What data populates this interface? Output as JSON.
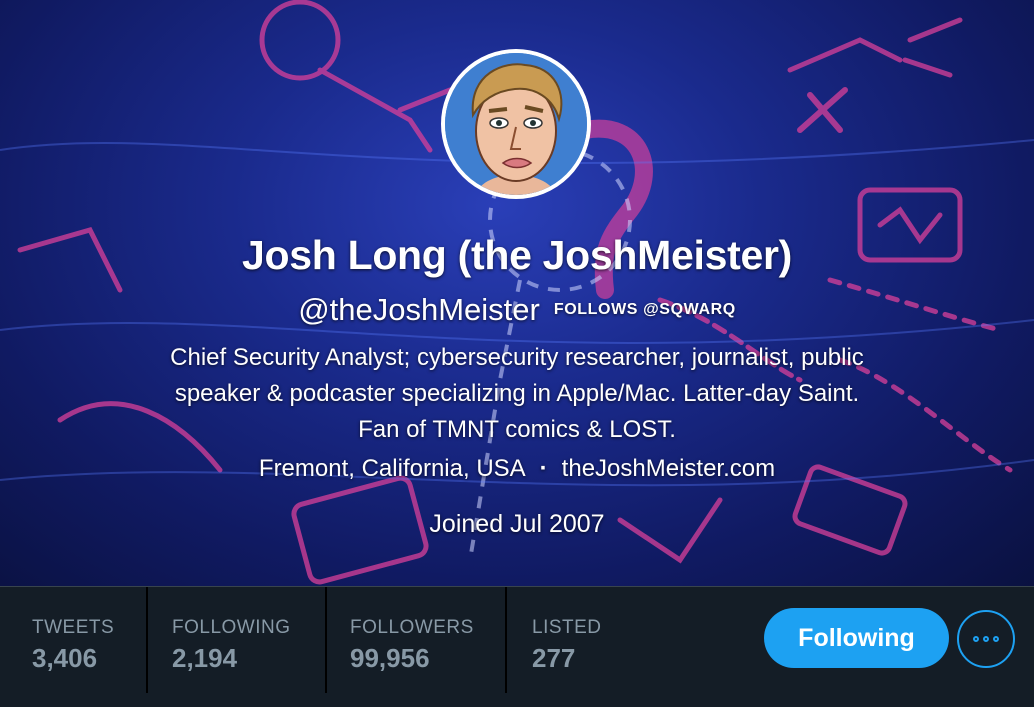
{
  "profile": {
    "name": "Josh Long (the JoshMeister)",
    "handle": "@theJoshMeister",
    "follows_badge": "FOLLOWS @SQWARQ",
    "bio_line1": "Chief Security Analyst; cybersecurity researcher, journalist, public",
    "bio_line2": "speaker & podcaster specializing in Apple/Mac. Latter-day Saint.",
    "bio_line3": "Fan of TMNT comics & LOST.",
    "location": "Fremont, California, USA",
    "separator": "·",
    "website": "theJoshMeister.com",
    "joined": "Joined Jul 2007"
  },
  "stats": [
    {
      "label": "TWEETS",
      "value": "3,406"
    },
    {
      "label": "FOLLOWING",
      "value": "2,194"
    },
    {
      "label": "FOLLOWERS",
      "value": "99,956"
    },
    {
      "label": "LISTED",
      "value": "277"
    }
  ],
  "actions": {
    "follow_label": "Following",
    "more_icon": "more-options-icon"
  },
  "colors": {
    "accent": "#1da1f2",
    "stats_bg": "#141d26",
    "stat_text": "#8899a6",
    "header_bg": "#1a2a8c",
    "doodle_pink": "#e0409a"
  }
}
